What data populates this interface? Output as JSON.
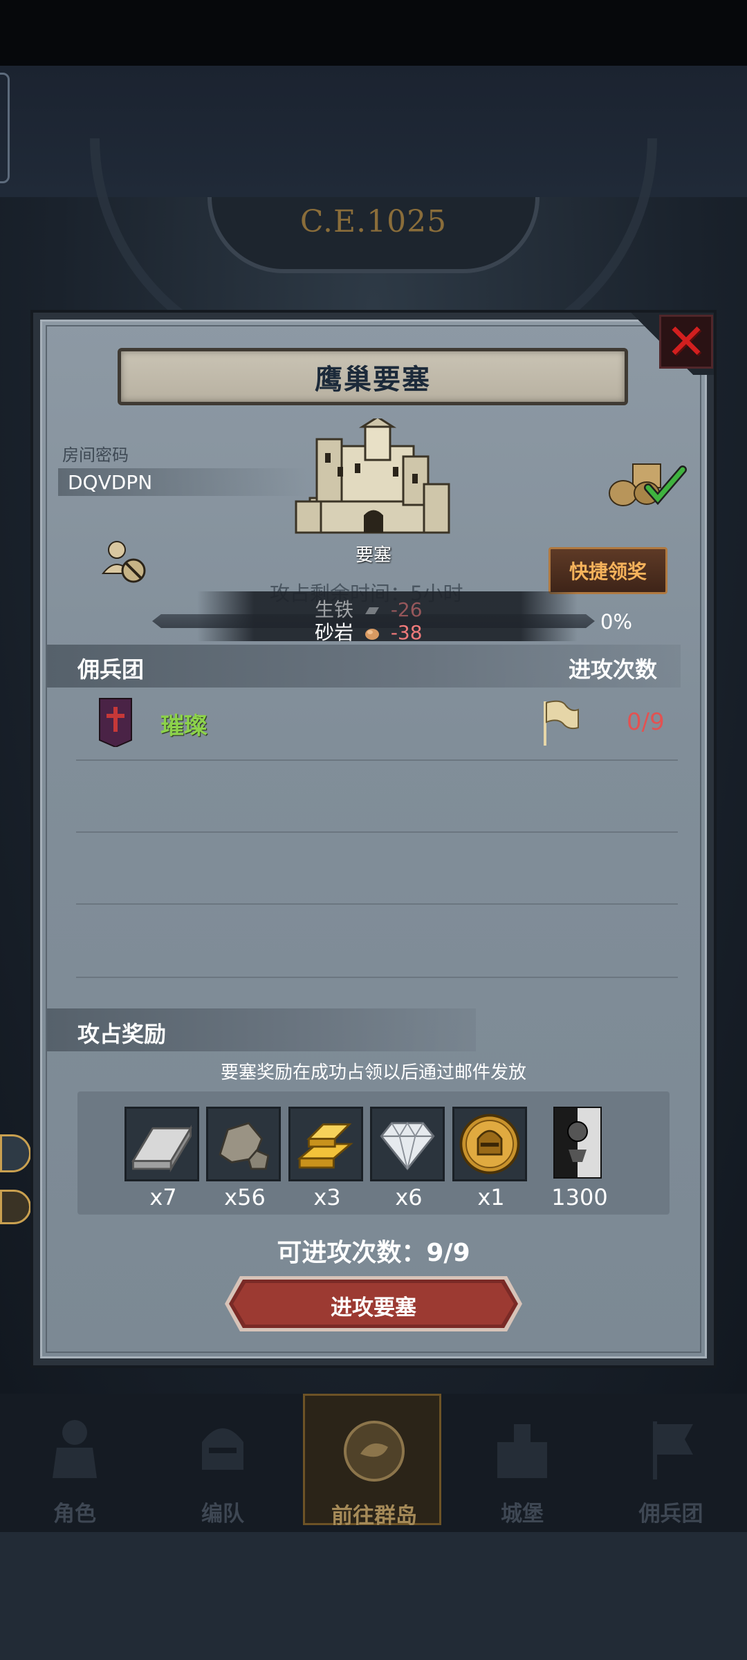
{
  "background": {
    "era_label": "C.E.1025"
  },
  "dialog": {
    "title": "鹰巢要塞",
    "room_code_label": "房间密码",
    "room_code": "DQVDPN",
    "castle_label": "要塞",
    "quick_reward_label": "快捷领奖",
    "occupy_time_text": "攻占剩余时间：5小时",
    "costs": [
      {
        "name": "生铁",
        "value": "-26",
        "icon": "iron-icon"
      },
      {
        "name": "砂岩",
        "value": "-38",
        "icon": "sandstone-icon"
      }
    ],
    "progress": {
      "percent_text": "0%",
      "value": 0
    },
    "mercenary_section_title": "佣兵团",
    "attack_count_header": "进攻次数",
    "guild": {
      "name": "璀璨",
      "attack_count": "0/9"
    },
    "reward_section_title": "攻占奖励",
    "reward_note": "要塞奖励在成功占领以后通过邮件发放",
    "rewards": [
      {
        "icon": "silver-ingot-icon",
        "qty": "x7"
      },
      {
        "icon": "stone-ore-icon",
        "qty": "x56"
      },
      {
        "icon": "gold-bars-icon",
        "qty": "x3"
      },
      {
        "icon": "diamond-icon",
        "qty": "x6"
      },
      {
        "icon": "helmet-coin-icon",
        "qty": "x1"
      },
      {
        "icon": "mercenary-banner-icon",
        "qty": "1300"
      }
    ],
    "attack_times_text": "可进攻次数：9/9",
    "attack_button_label": "进攻要塞",
    "colors": {
      "guild_name": "#8cd24a",
      "attack_count": "#e25252",
      "quick_reward_text": "#f6b25b",
      "close": "#d21f1f"
    }
  },
  "bottom_nav": {
    "items": [
      {
        "label": "角色",
        "icon": "knight-icon",
        "active": false
      },
      {
        "label": "编队",
        "icon": "helmet-icon",
        "active": false
      },
      {
        "label": "前往群岛",
        "icon": "compass-icon",
        "active": true
      },
      {
        "label": "城堡",
        "icon": "castle-icon",
        "active": false
      },
      {
        "label": "佣兵团",
        "icon": "flag-icon",
        "active": false
      }
    ]
  }
}
